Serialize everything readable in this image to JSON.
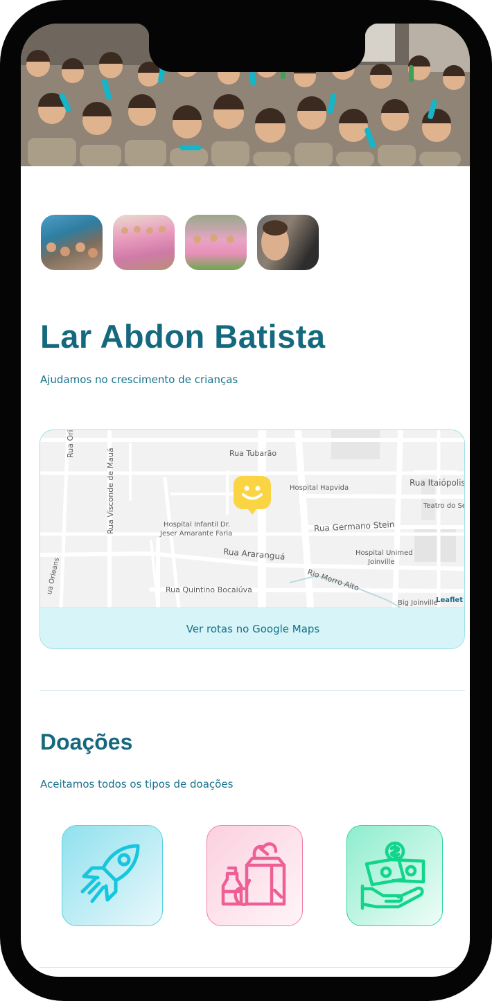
{
  "org": {
    "name": "Lar Abdon Batista",
    "tagline": "Ajudamos no crescimento de crianças"
  },
  "gallery": {
    "thumbnails": [
      "photo-1",
      "photo-2",
      "photo-3",
      "photo-4"
    ]
  },
  "map": {
    "streets": {
      "rua_tubarao": "Rua Tubarão",
      "rua_itaiopolis": "Rua Itaiópolis",
      "hospital_hapvida": "Hospital Hapvida",
      "teatro": "Teatro do Se",
      "hospital_infantil_line1": "Hospital Infantil Dr.",
      "hospital_infantil_line2": "Jeser Amarante Faria",
      "rua_germano_stein": "Rua Germano Stein",
      "rua_visconde_de_maua": "Rua Visconde de Mauá",
      "rua_ararangua": "Rua Araranguá",
      "hospital_unimed_line1": "Hospital Unimed",
      "hospital_unimed_line2": "Joinville",
      "rio_morro_alto": "Rio Morro Alto",
      "rua_orleans": "ua Orleans",
      "rua_quintino": "Rua Quintino Bocaiúva",
      "big_joinville": "Big Joinville",
      "rua_ori": "Rua Ori"
    },
    "attribution": "Leaflet",
    "routes_button": "Ver rotas no Google Maps",
    "marker_icon": "smile-marker-icon"
  },
  "donations": {
    "title": "Doações",
    "subtitle": "Aceitamos todos os tipos de doações",
    "cards": [
      {
        "icon": "rocket-icon",
        "color": "#16c6dd"
      },
      {
        "icon": "groceries-icon",
        "color": "#ee5f95"
      },
      {
        "icon": "money-hand-icon",
        "color": "#12d58c"
      }
    ]
  },
  "colors": {
    "primary": "#15697e",
    "marker": "#fbd444",
    "map_button_bg": "#d7f5f8"
  }
}
